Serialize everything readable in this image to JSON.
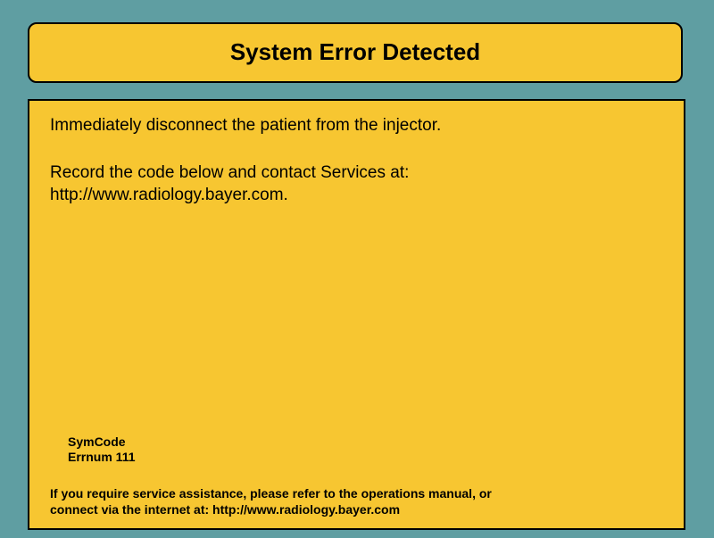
{
  "header": {
    "title": "System Error Detected"
  },
  "message": {
    "line1": "Immediately disconnect the patient from the injector.",
    "line2": "Record the code below and contact Services at:",
    "line3": "http://www.radiology.bayer.com."
  },
  "error_code": {
    "symcode_label": "SymCode",
    "errnum": "Errnum 111"
  },
  "footer": {
    "line1": "If you require service assistance, please refer to the operations manual, or",
    "line2": "connect via the internet at: http://www.radiology.bayer.com"
  },
  "colors": {
    "background": "#5f9ea2",
    "panel": "#f7c631",
    "border": "#000000"
  }
}
